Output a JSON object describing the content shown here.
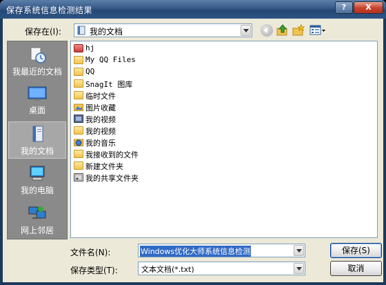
{
  "window": {
    "title": "保存系统信息检测结果",
    "help_glyph": "?",
    "close_glyph": "X"
  },
  "toolbar": {
    "save_in_label": "保存在(I):",
    "save_in_value": "我的文档"
  },
  "places": [
    {
      "label": "我最近的文档",
      "icon": "recent-documents-icon"
    },
    {
      "label": "桌面",
      "icon": "desktop-icon"
    },
    {
      "label": "我的文档",
      "icon": "my-documents-icon",
      "selected": true
    },
    {
      "label": "我的电脑",
      "icon": "my-computer-icon"
    },
    {
      "label": "网上邻居",
      "icon": "network-places-icon"
    }
  ],
  "files": [
    {
      "name": "hj",
      "icon": "special-folder-icon"
    },
    {
      "name": "My QQ Files",
      "icon": "folder-icon"
    },
    {
      "name": "QQ",
      "icon": "folder-icon"
    },
    {
      "name": "SnagIt 图库",
      "icon": "folder-icon"
    },
    {
      "name": "临时文件",
      "icon": "folder-icon"
    },
    {
      "name": "图片收藏",
      "icon": "pictures-folder-icon"
    },
    {
      "name": "我的视频",
      "icon": "videos-folder-icon"
    },
    {
      "name": "我的视频",
      "icon": "folder-icon"
    },
    {
      "name": "我的音乐",
      "icon": "music-folder-icon"
    },
    {
      "name": "我接收到的文件",
      "icon": "folder-icon"
    },
    {
      "name": "新建文件夹",
      "icon": "folder-icon"
    },
    {
      "name": "我的共享文件夹",
      "icon": "shared-folder-icon"
    }
  ],
  "form": {
    "filename_label": "文件名(N):",
    "filename_value": "Windows优化大师系统信息检测",
    "filetype_label": "保存类型(T):",
    "filetype_value": "文本文档(*.txt)"
  },
  "buttons": {
    "save": "保存(S)",
    "cancel": "取消"
  },
  "colors": {
    "title_bar": "#2e5584",
    "places_bar": "#8a8a8a",
    "selection": "#316ac5",
    "dialog_bg": "#ece9d8"
  }
}
